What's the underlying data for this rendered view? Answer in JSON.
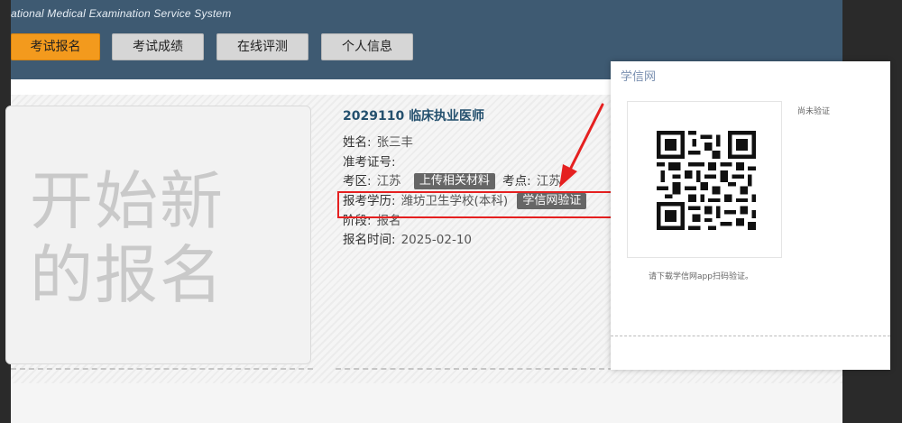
{
  "header": {
    "system_title": "ational Medical Examination Service System",
    "tabs": [
      {
        "label": "考试报名",
        "active": true
      },
      {
        "label": "考试成绩",
        "active": false
      },
      {
        "label": "在线评测",
        "active": false
      },
      {
        "label": "个人信息",
        "active": false
      }
    ]
  },
  "new_registration": {
    "text": "开始新的报名"
  },
  "exam": {
    "title": "2029110 临床执业医师",
    "name_label": "姓名:",
    "name_value": "张三丰",
    "ticket_label": "准考证号:",
    "area_label": "考区:",
    "area_value": "江苏",
    "upload_button": "上传相关材料",
    "site_label": "考点:",
    "site_value": "江苏",
    "edu_label": "报考学历:",
    "edu_value": "潍坊卫生学校(本科)",
    "verify_button": "学信网验证",
    "stage_label": "阶段:",
    "stage_value": "报名",
    "time_label": "报名时间:",
    "time_value": "2025-02-10"
  },
  "popup": {
    "title": "学信网",
    "status": "尚未验证",
    "hint": "请下载学信网app扫码验证。"
  },
  "colors": {
    "accent": "#f39a1d",
    "header_bg": "#3e5a72",
    "highlight": "#e52020"
  }
}
